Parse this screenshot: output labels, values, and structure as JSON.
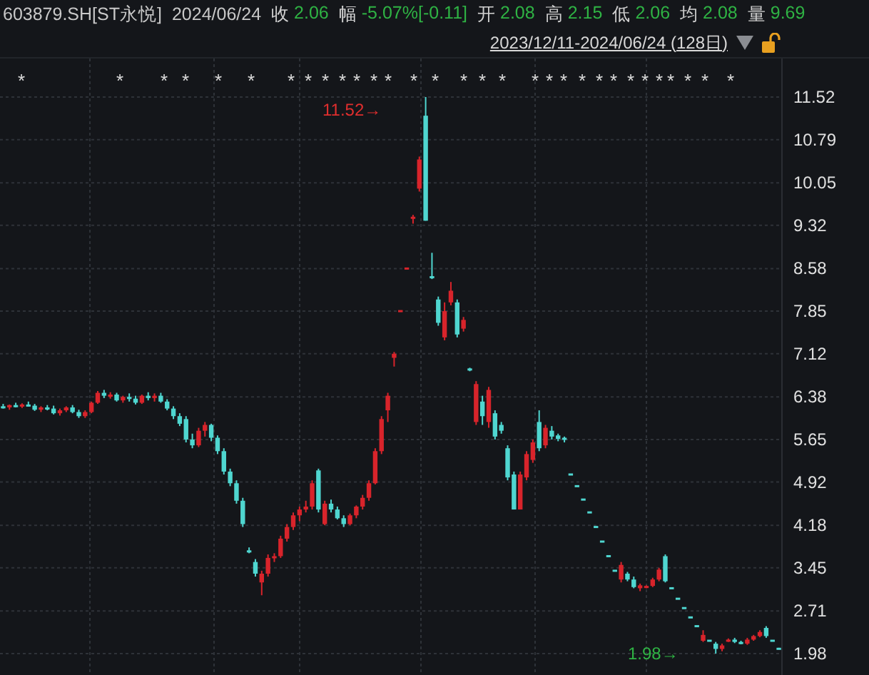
{
  "header": {
    "symbol": "603879.SH[ST永悦]",
    "date": "2024/06/24",
    "stats": [
      {
        "label": "收",
        "value": "2.06"
      },
      {
        "label": "幅",
        "value": "-5.07%[-0.11]"
      },
      {
        "label": "开",
        "value": "2.08"
      },
      {
        "label": "高",
        "value": "2.15"
      },
      {
        "label": "低",
        "value": "2.06"
      },
      {
        "label": "均",
        "value": "2.08"
      },
      {
        "label": "量",
        "value": "9.69"
      }
    ]
  },
  "range": {
    "label": "2023/12/11-2024/06/24 (128日)"
  },
  "chart": {
    "event_marks": [
      "*",
      "*",
      "*",
      "*",
      "*",
      "*",
      "*",
      "*",
      "*",
      "*",
      "*",
      "*",
      "*",
      "*",
      "*",
      "*",
      "*",
      "*",
      "*",
      "*",
      "*",
      "*",
      "*",
      "*",
      "*",
      "*",
      "*",
      "*",
      "*",
      "*",
      "*"
    ],
    "high_marker": "11.52→",
    "low_marker": "1.98→",
    "chart_data": {
      "type": "candlestick",
      "grid": true,
      "categories": [
        null,
        null,
        null,
        null,
        null,
        null,
        null,
        null,
        null,
        null,
        null,
        null,
        null,
        null,
        null,
        null,
        null,
        null,
        null,
        null,
        null,
        null,
        null,
        null,
        null,
        null,
        null,
        null,
        null,
        null,
        null,
        null,
        null,
        null,
        null,
        null,
        null,
        null,
        null,
        null,
        null,
        null,
        null,
        null,
        null,
        null,
        null,
        null,
        null,
        null,
        null,
        null,
        null,
        null,
        null,
        null,
        null,
        null,
        null,
        null,
        null,
        null,
        null,
        null,
        null,
        null,
        null,
        null,
        null,
        null,
        null,
        null,
        null,
        null,
        null,
        null,
        null,
        null,
        null,
        null,
        null,
        null,
        null,
        null,
        null,
        null,
        null,
        null,
        null,
        null,
        null,
        null,
        null,
        null,
        null,
        null,
        null,
        null,
        null,
        null,
        null,
        null,
        null,
        null,
        null,
        null,
        null,
        null,
        null,
        null,
        null,
        null,
        null,
        null,
        null,
        null,
        null,
        null,
        null,
        null,
        null,
        null,
        null,
        null
      ],
      "ylim": [
        1.98,
        11.52
      ],
      "yticks": [
        11.52,
        10.79,
        10.05,
        9.32,
        8.58,
        7.85,
        7.12,
        6.38,
        5.65,
        4.92,
        4.18,
        3.45,
        2.71,
        1.98
      ],
      "ohlc": [
        [
          6.22,
          6.26,
          6.18,
          6.2
        ],
        [
          6.2,
          6.25,
          6.16,
          6.24
        ],
        [
          6.24,
          6.28,
          6.2,
          6.22
        ],
        [
          6.22,
          6.27,
          6.19,
          6.25
        ],
        [
          6.25,
          6.3,
          6.22,
          6.23
        ],
        [
          6.23,
          6.26,
          6.14,
          6.16
        ],
        [
          6.16,
          6.22,
          6.12,
          6.2
        ],
        [
          6.2,
          6.24,
          6.15,
          6.18
        ],
        [
          6.18,
          6.23,
          6.08,
          6.1
        ],
        [
          6.1,
          6.18,
          6.06,
          6.15
        ],
        [
          6.15,
          6.22,
          6.12,
          6.2
        ],
        [
          6.2,
          6.24,
          6.1,
          6.12
        ],
        [
          6.12,
          6.16,
          6.02,
          6.05
        ],
        [
          6.05,
          6.15,
          6.02,
          6.12
        ],
        [
          6.12,
          6.3,
          6.1,
          6.28
        ],
        [
          6.28,
          6.48,
          6.26,
          6.45
        ],
        [
          6.45,
          6.5,
          6.36,
          6.4
        ],
        [
          6.4,
          6.46,
          6.35,
          6.42
        ],
        [
          6.42,
          6.45,
          6.3,
          6.32
        ],
        [
          6.32,
          6.4,
          6.28,
          6.38
        ],
        [
          6.38,
          6.44,
          6.3,
          6.35
        ],
        [
          6.35,
          6.4,
          6.25,
          6.28
        ],
        [
          6.28,
          6.42,
          6.26,
          6.4
        ],
        [
          6.4,
          6.46,
          6.32,
          6.36
        ],
        [
          6.36,
          6.44,
          6.3,
          6.4
        ],
        [
          6.4,
          6.45,
          6.28,
          6.3
        ],
        [
          6.3,
          6.34,
          6.15,
          6.18
        ],
        [
          6.18,
          6.22,
          6.0,
          6.05
        ],
        [
          6.05,
          6.1,
          5.88,
          5.92
        ],
        [
          6.0,
          6.05,
          5.6,
          5.65
        ],
        [
          5.65,
          5.75,
          5.5,
          5.55
        ],
        [
          5.55,
          5.85,
          5.52,
          5.8
        ],
        [
          5.8,
          5.95,
          5.7,
          5.9
        ],
        [
          5.9,
          5.92,
          5.62,
          5.68
        ],
        [
          5.68,
          5.72,
          5.4,
          5.45
        ],
        [
          5.45,
          5.5,
          5.05,
          5.1
        ],
        [
          5.1,
          5.15,
          4.85,
          4.9
        ],
        [
          4.9,
          4.95,
          4.55,
          4.6
        ],
        [
          4.6,
          4.65,
          4.15,
          4.2
        ],
        [
          3.75,
          3.8,
          3.7,
          3.72
        ],
        [
          3.55,
          3.6,
          3.3,
          3.35
        ],
        [
          3.2,
          3.4,
          2.98,
          3.35
        ],
        [
          3.35,
          3.68,
          3.3,
          3.62
        ],
        [
          3.62,
          3.7,
          3.55,
          3.65
        ],
        [
          3.65,
          4.0,
          3.62,
          3.95
        ],
        [
          3.95,
          4.2,
          3.9,
          4.15
        ],
        [
          4.15,
          4.4,
          4.1,
          4.35
        ],
        [
          4.35,
          4.5,
          4.25,
          4.45
        ],
        [
          4.45,
          4.6,
          4.4,
          4.5
        ],
        [
          4.5,
          4.95,
          4.45,
          4.9
        ],
        [
          5.12,
          5.15,
          4.4,
          4.45
        ],
        [
          4.2,
          4.6,
          4.18,
          4.55
        ],
        [
          4.55,
          4.62,
          4.4,
          4.45
        ],
        [
          4.45,
          4.5,
          4.28,
          4.3
        ],
        [
          4.3,
          4.35,
          4.15,
          4.2
        ],
        [
          4.2,
          4.38,
          4.18,
          4.35
        ],
        [
          4.35,
          4.52,
          4.3,
          4.5
        ],
        [
          4.5,
          4.7,
          4.45,
          4.65
        ],
        [
          4.65,
          4.95,
          4.6,
          4.9
        ],
        [
          4.9,
          5.5,
          4.88,
          5.45
        ],
        [
          5.45,
          6.05,
          5.4,
          6.0
        ],
        [
          6.15,
          6.45,
          5.95,
          6.4
        ],
        [
          7.05,
          7.15,
          6.9,
          7.12
        ],
        [
          7.85,
          7.85,
          7.85,
          7.85
        ],
        [
          8.58,
          8.58,
          8.58,
          8.58
        ],
        [
          9.45,
          9.5,
          9.35,
          9.45
        ],
        [
          9.95,
          10.5,
          9.9,
          10.45
        ],
        [
          11.2,
          11.52,
          9.4,
          9.4
        ],
        [
          8.45,
          8.85,
          8.4,
          8.42
        ],
        [
          8.05,
          8.1,
          7.6,
          7.65
        ],
        [
          7.4,
          8.0,
          7.35,
          7.85
        ],
        [
          8.0,
          8.35,
          7.95,
          8.2
        ],
        [
          8.0,
          8.05,
          7.4,
          7.45
        ],
        [
          7.55,
          7.75,
          7.5,
          7.7
        ],
        [
          6.85,
          6.88,
          6.82,
          6.85
        ],
        [
          5.95,
          6.65,
          5.9,
          6.6
        ],
        [
          6.3,
          6.4,
          5.9,
          6.05
        ],
        [
          5.95,
          6.55,
          5.85,
          6.5
        ],
        [
          6.1,
          6.15,
          5.65,
          5.7
        ],
        [
          5.9,
          5.95,
          5.75,
          5.8
        ],
        [
          5.5,
          5.55,
          4.95,
          5.0
        ],
        [
          5.05,
          5.1,
          4.45,
          4.45
        ],
        [
          4.45,
          5.1,
          4.45,
          5.05
        ],
        [
          5.0,
          5.45,
          4.95,
          5.4
        ],
        [
          5.3,
          5.65,
          5.25,
          5.6
        ],
        [
          5.95,
          6.15,
          5.45,
          5.5
        ],
        [
          5.55,
          5.9,
          5.5,
          5.85
        ],
        [
          5.8,
          5.88,
          5.65,
          5.7
        ],
        [
          5.72,
          5.75,
          5.62,
          5.66
        ],
        [
          5.68,
          5.7,
          5.6,
          5.65
        ],
        [
          5.05,
          5.05,
          5.05,
          5.05
        ],
        [
          4.85,
          4.85,
          4.85,
          4.85
        ],
        [
          4.62,
          4.62,
          4.62,
          4.62
        ],
        [
          4.4,
          4.4,
          4.4,
          4.4
        ],
        [
          4.15,
          4.15,
          4.15,
          4.15
        ],
        [
          3.9,
          3.9,
          3.9,
          3.9
        ],
        [
          3.65,
          3.65,
          3.65,
          3.65
        ],
        [
          3.4,
          3.4,
          3.4,
          3.4
        ],
        [
          3.25,
          3.55,
          3.2,
          3.5
        ],
        [
          3.35,
          3.38,
          3.22,
          3.25
        ],
        [
          3.25,
          3.3,
          3.1,
          3.12
        ],
        [
          3.1,
          3.18,
          3.05,
          3.15
        ],
        [
          3.12,
          3.15,
          3.1,
          3.14
        ],
        [
          3.14,
          3.28,
          3.12,
          3.25
        ],
        [
          3.25,
          3.45,
          3.22,
          3.42
        ],
        [
          3.65,
          3.68,
          3.2,
          3.22
        ],
        [
          3.1,
          3.1,
          3.1,
          3.1
        ],
        [
          2.92,
          2.92,
          2.92,
          2.92
        ],
        [
          2.76,
          2.76,
          2.76,
          2.76
        ],
        [
          2.6,
          2.6,
          2.6,
          2.6
        ],
        [
          2.45,
          2.45,
          2.45,
          2.45
        ],
        [
          2.2,
          2.38,
          2.18,
          2.3
        ],
        [
          2.2,
          2.2,
          2.2,
          2.2
        ],
        [
          2.15,
          2.18,
          1.98,
          2.06
        ],
        [
          2.06,
          2.15,
          2.02,
          2.12
        ],
        [
          2.2,
          2.24,
          2.18,
          2.22
        ],
        [
          2.22,
          2.25,
          2.16,
          2.18
        ],
        [
          2.18,
          2.2,
          2.14,
          2.15
        ],
        [
          2.15,
          2.25,
          2.13,
          2.22
        ],
        [
          2.22,
          2.3,
          2.2,
          2.28
        ],
        [
          2.28,
          2.38,
          2.26,
          2.35
        ],
        [
          2.42,
          2.45,
          2.25,
          2.28
        ],
        [
          2.2,
          2.2,
          2.2,
          2.2
        ],
        [
          2.08,
          2.08,
          2.06,
          2.06
        ]
      ]
    }
  }
}
